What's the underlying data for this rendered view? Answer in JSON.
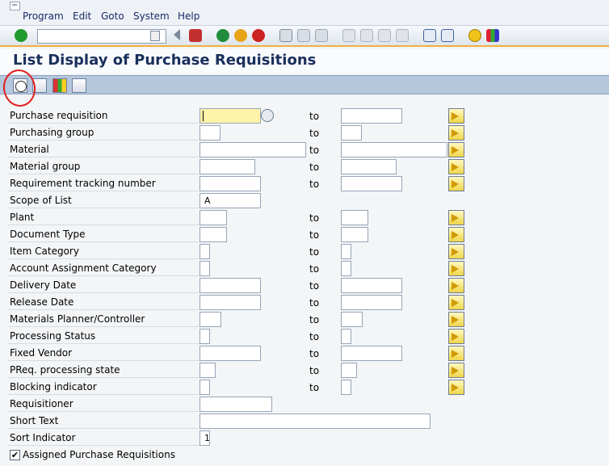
{
  "menu": {
    "program": "Program",
    "edit": "Edit",
    "goto": "Goto",
    "system": "System",
    "help": "Help"
  },
  "title": "List Display of Purchase Requisitions",
  "to_label": "to",
  "fields": [
    {
      "label": "Purchase requisition",
      "value": "",
      "multi": true
    },
    {
      "label": "Purchasing group",
      "value": "",
      "multi": true
    },
    {
      "label": "Material",
      "value": "",
      "multi": true
    },
    {
      "label": "Material group",
      "value": "",
      "multi": true
    },
    {
      "label": "Requirement tracking number",
      "value": "",
      "multi": true
    },
    {
      "label": "Scope of List",
      "value": "A",
      "multi": false
    },
    {
      "label": "Plant",
      "value": "",
      "multi": true
    },
    {
      "label": "Document Type",
      "value": "",
      "multi": true
    },
    {
      "label": "Item Category",
      "value": "",
      "multi": true
    },
    {
      "label": "Account Assignment Category",
      "value": "",
      "multi": true
    },
    {
      "label": "Delivery Date",
      "value": "",
      "multi": true
    },
    {
      "label": "Release Date",
      "value": "",
      "multi": true
    },
    {
      "label": "Materials Planner/Controller",
      "value": "",
      "multi": true
    },
    {
      "label": "Processing Status",
      "value": "",
      "multi": true
    },
    {
      "label": "Fixed Vendor",
      "value": "",
      "multi": true
    },
    {
      "label": "PReq. processing state",
      "value": "",
      "multi": true
    },
    {
      "label": "Blocking indicator",
      "value": "",
      "multi": true
    },
    {
      "label": "Requisitioner",
      "value": "",
      "multi": false
    },
    {
      "label": "Short Text",
      "value": "",
      "multi": false
    },
    {
      "label": "Sort Indicator",
      "value": "1",
      "multi": false
    }
  ],
  "checkbox": {
    "label": "Assigned Purchase Requisitions",
    "checked": true
  }
}
